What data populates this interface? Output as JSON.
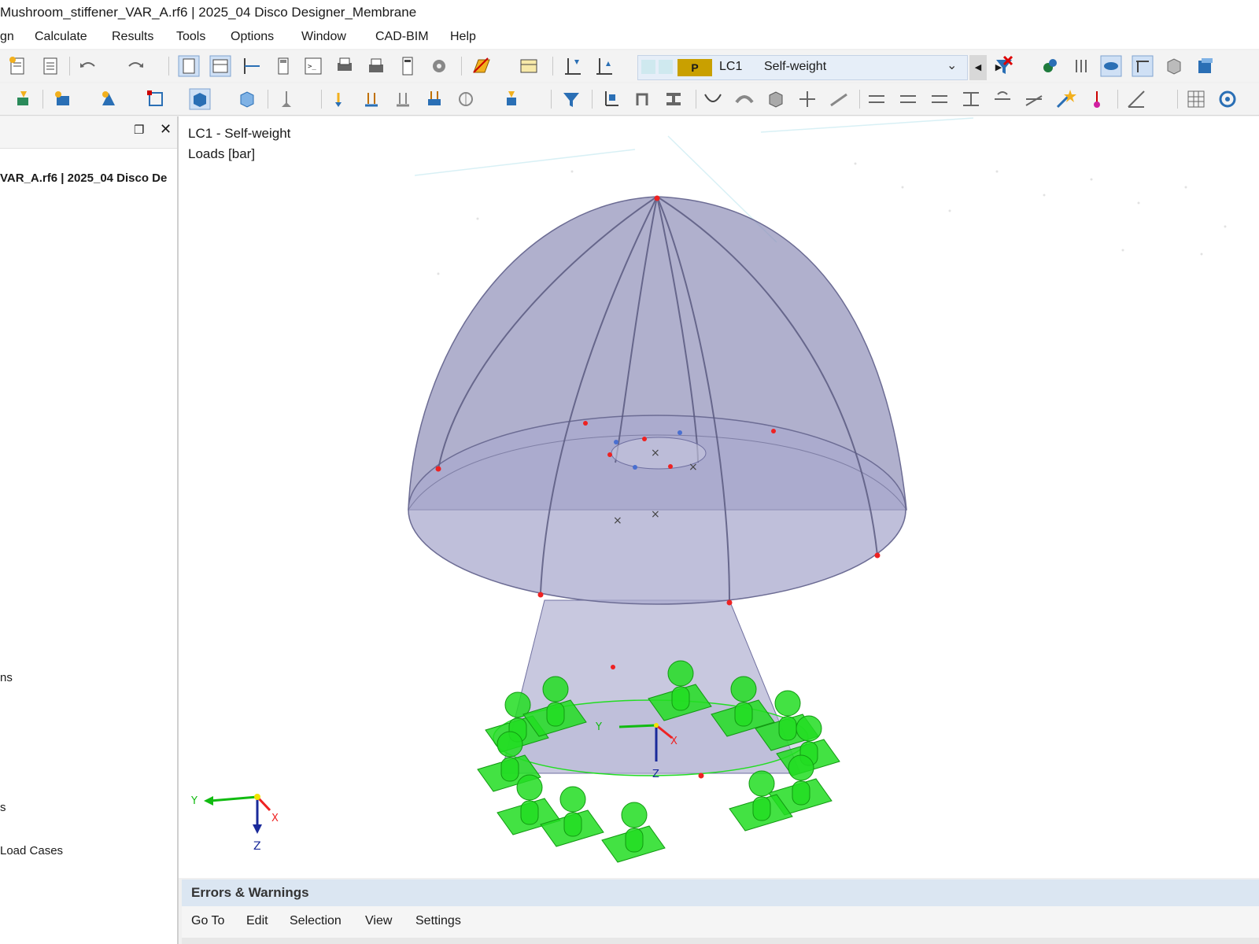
{
  "window": {
    "title": "Mushroom_stiffener_VAR_A.rf6 | 2025_04 Disco Designer_Membrane"
  },
  "menu": [
    "gn",
    "Calculate",
    "Results",
    "Tools",
    "Options",
    "Window",
    "CAD-BIM",
    "Help"
  ],
  "load_case": {
    "type_badge": "P",
    "id": "LC1",
    "name": "Self-weight"
  },
  "navigator": {
    "project_label": "VAR_A.rf6 | 2025_04 Disco De",
    "items": [
      "ns",
      "s",
      "Load Cases"
    ]
  },
  "viewport": {
    "title": "LC1 - Self-weight",
    "subtitle": "Loads [bar]",
    "axis_labels": {
      "x": "X",
      "y": "Y",
      "z": "Z"
    }
  },
  "bottom_panel": {
    "title": "Errors & Warnings",
    "menu": [
      "Go To",
      "Edit",
      "Selection",
      "View",
      "Settings"
    ]
  },
  "colors": {
    "shell_fill": "#8f8fb8",
    "support_green": "#22dd22",
    "axis_x": "#ee2222",
    "axis_y": "#11bb11",
    "axis_z": "#1a2a9a",
    "lc_badge": "#c9a000"
  }
}
